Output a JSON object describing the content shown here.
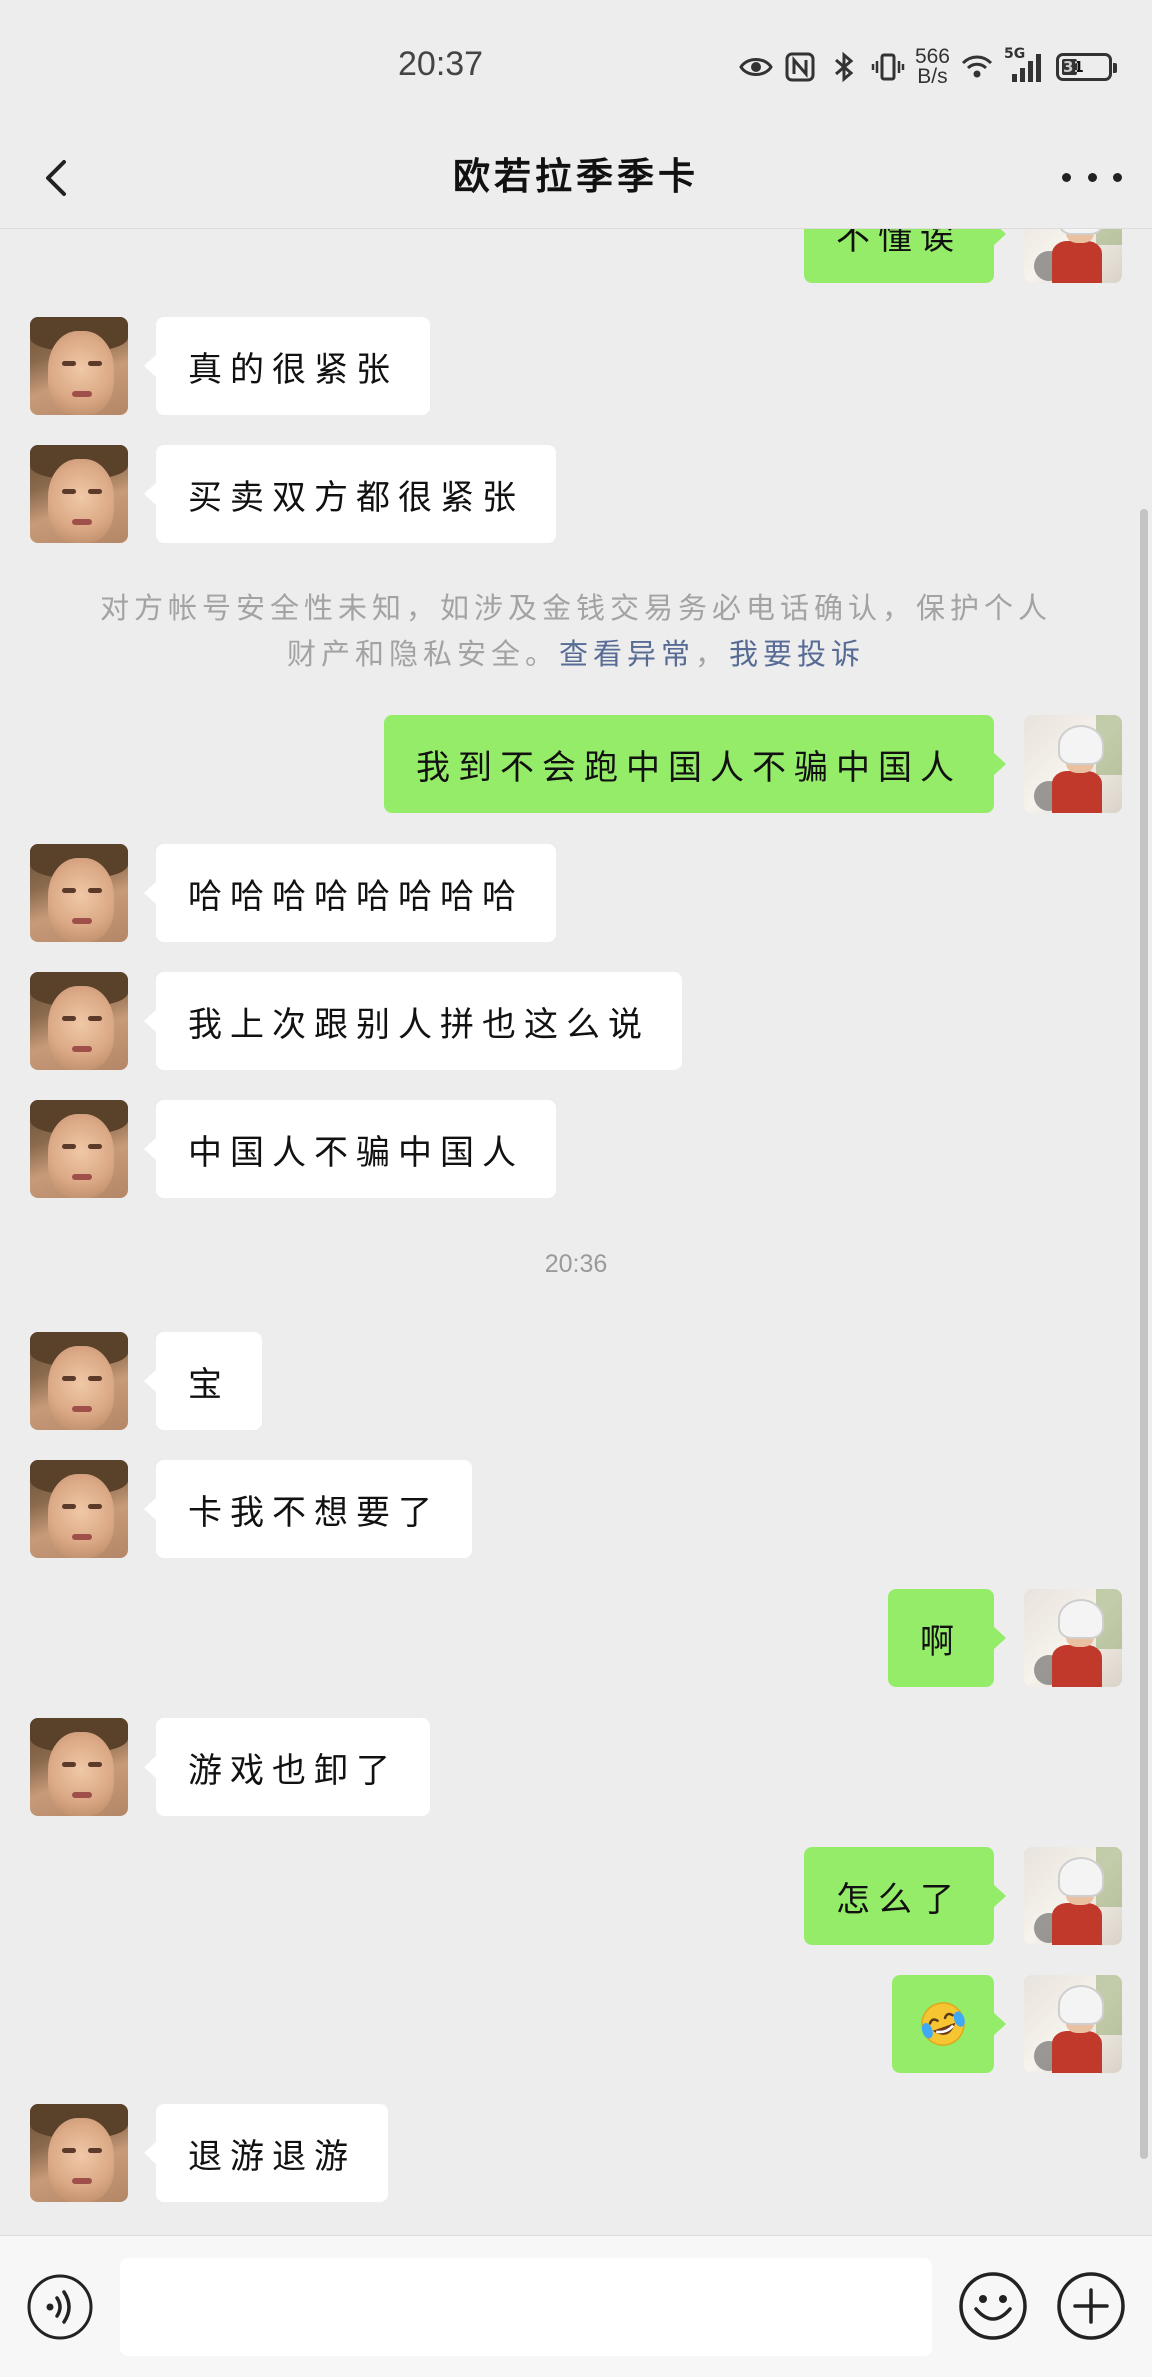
{
  "status_bar": {
    "time": "20:37",
    "net_speed_value": "566",
    "net_speed_unit": "B/s",
    "network_type": "5G",
    "battery": "31",
    "icons": [
      "eye-icon",
      "nfc-icon",
      "bluetooth-icon",
      "vibrate-icon",
      "wifi-icon",
      "signal-icon",
      "battery-icon"
    ]
  },
  "nav": {
    "title": "欧若拉季季卡",
    "back_icon": "chevron-left-icon",
    "more_icon": "more-dots-icon"
  },
  "messages": [
    {
      "side": "out",
      "text": "不懂诶"
    },
    {
      "side": "in",
      "text": "真的很紧张"
    },
    {
      "side": "in",
      "text": "买卖双方都很紧张"
    },
    {
      "side": "out",
      "text": "我到不会跑中国人不骗中国人"
    },
    {
      "side": "in",
      "text": "哈哈哈哈哈哈哈哈"
    },
    {
      "side": "in",
      "text": "我上次跟别人拼也这么说"
    },
    {
      "side": "in",
      "text": "中国人不骗中国人"
    },
    {
      "side": "in",
      "text": "宝"
    },
    {
      "side": "in",
      "text": "卡我不想要了"
    },
    {
      "side": "out",
      "text": "啊"
    },
    {
      "side": "in",
      "text": "游戏也卸了"
    },
    {
      "side": "out",
      "text": "怎么了"
    },
    {
      "side": "out",
      "text": "",
      "emoji": "tears-of-joy-emoji"
    },
    {
      "side": "in",
      "text": "退游退游"
    }
  ],
  "security_notice": {
    "line1": "对方帐号安全性未知，如涉及金钱交易务必电话确认，保护个人",
    "line2_prefix": "财产和隐私安全。",
    "link_view": "查看异常",
    "separator": "，",
    "link_report": "我要投诉"
  },
  "timestamp": "20:36",
  "input_bar": {
    "placeholder": "",
    "voice_icon": "voice-icon",
    "emoji_icon": "emoji-icon",
    "plus_icon": "plus-icon"
  },
  "colors": {
    "background": "#ededed",
    "bubble_out": "#95ec69",
    "bubble_in": "#ffffff",
    "link": "#576b95"
  }
}
